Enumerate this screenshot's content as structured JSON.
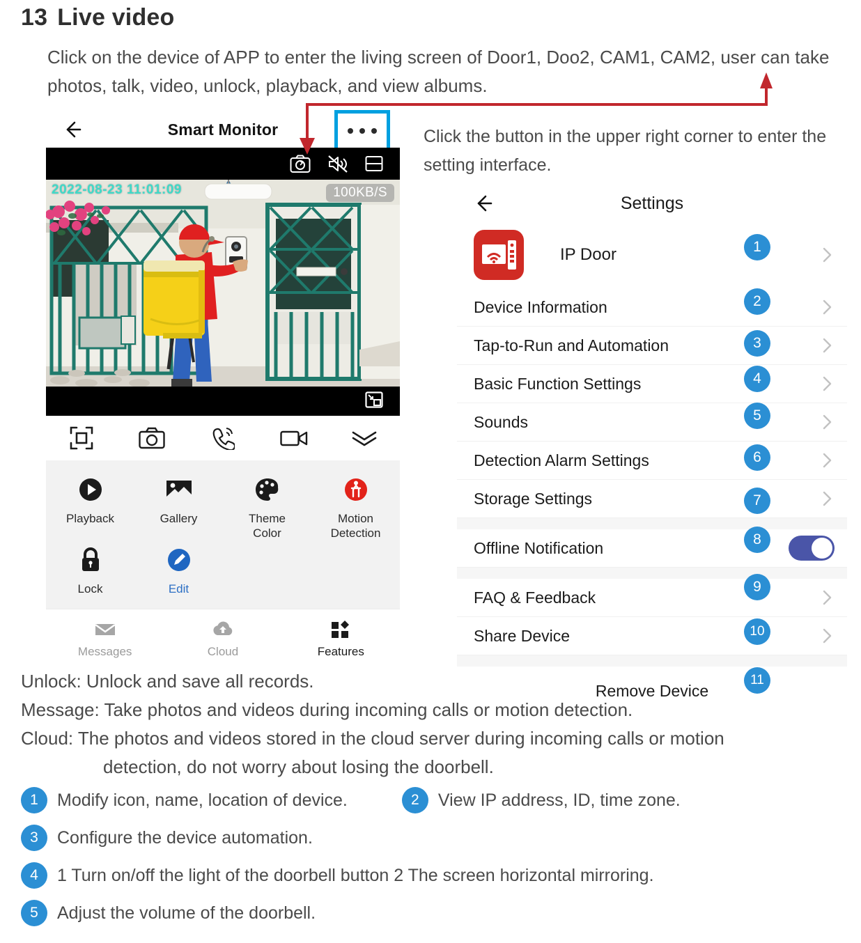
{
  "section": {
    "number": "13",
    "title": "Live video",
    "intro": "Click on the device of APP to enter the living screen of Door1, Doo2, CAM1, CAM2, user can take photos, talk, video, unlock, playback, and view albums."
  },
  "phone": {
    "header": {
      "back_icon": "back-arrow-icon",
      "title": "Smart Monitor",
      "more_icon": "more-options-icon"
    },
    "video": {
      "timestamp": "2022-08-23  11:01:09",
      "bitrate": "100KB/S",
      "top_icons": [
        "snapshot-icon",
        "mute-icon",
        "split-screen-icon"
      ],
      "bottom_icon": "picture-in-picture-icon"
    },
    "controls": [
      {
        "name": "fullscreen-icon",
        "label": ""
      },
      {
        "name": "camera-icon",
        "label": ""
      },
      {
        "name": "talk-icon",
        "label": ""
      },
      {
        "name": "record-icon",
        "label": ""
      },
      {
        "name": "collapse-icon",
        "label": ""
      }
    ],
    "features": [
      {
        "label": "Playback",
        "icon": "play-icon"
      },
      {
        "label": "Gallery",
        "icon": "gallery-icon"
      },
      {
        "label": "Theme\nColor",
        "label_line1": "Theme",
        "label_line2": "Color",
        "icon": "palette-icon"
      },
      {
        "label": "Motion\nDetection",
        "label_line1": "Motion",
        "label_line2": "Detection",
        "icon": "motion-detection-icon"
      },
      {
        "label": "Lock",
        "icon": "lock-icon"
      },
      {
        "label": "Edit",
        "icon": "edit-icon"
      }
    ],
    "tabs": [
      {
        "label": "Messages",
        "icon": "mail-icon",
        "active": false
      },
      {
        "label": "Cloud",
        "icon": "cloud-icon",
        "active": false
      },
      {
        "label": "Features",
        "icon": "grid-icon",
        "active": true
      }
    ]
  },
  "right_note": "Click the button in the upper right corner to enter the setting interface.",
  "settings": {
    "back_icon": "back-arrow-icon",
    "title": "Settings",
    "device": {
      "name": "IP Door",
      "icon": "ip-door-icon",
      "badge": "1"
    },
    "rows": [
      {
        "label": "Device Information",
        "badge": "2",
        "control": "chevron"
      },
      {
        "label": "Tap-to-Run and Automation",
        "badge": "3",
        "control": "chevron"
      },
      {
        "label": "Basic Function Settings",
        "badge": "4",
        "control": "chevron"
      },
      {
        "label": "Sounds",
        "badge": "5",
        "control": "chevron"
      },
      {
        "label": "Detection Alarm Settings",
        "badge": "6",
        "control": "chevron"
      },
      {
        "label": "Storage Settings",
        "badge": "7",
        "control": "chevron"
      },
      {
        "label": "Offline Notification",
        "badge": "8",
        "control": "toggle",
        "toggle_on": true
      },
      {
        "label": "FAQ & Feedback",
        "badge": "9",
        "control": "chevron"
      },
      {
        "label": "Share Device",
        "badge": "10",
        "control": "chevron"
      },
      {
        "label": "Remove Device",
        "badge": "11",
        "control": "none",
        "centered": true
      }
    ]
  },
  "descriptions": {
    "line1": "Unlock: Unlock and save all records.",
    "line2": "Message: Take photos and videos during incoming calls or motion detection.",
    "line3": "Cloud: The photos and videos stored in the cloud server during incoming calls or motion",
    "line3b": "detection, do not worry about losing the doorbell."
  },
  "legend": [
    {
      "num": "1",
      "text": "Modify icon, name, location of device."
    },
    {
      "num": "2",
      "text": "View IP address, ID, time zone."
    },
    {
      "num": "3",
      "text": "Configure the device automation."
    },
    {
      "num": "4",
      "text": "1  Turn on/off the light of the doorbell button  2  The screen horizontal mirroring."
    },
    {
      "num": "5",
      "text": "Adjust the volume of the doorbell."
    }
  ],
  "colors": {
    "badge_blue": "#2B8FD4",
    "toggle_indigo": "#4A55A8",
    "highlight_cyan": "#00A0E0",
    "annotation_red": "#C1272D",
    "device_red": "#D02B24",
    "edit_blue": "#2C6FC4",
    "motion_red": "#E2231A",
    "timestamp_teal": "#3FD9C8"
  }
}
